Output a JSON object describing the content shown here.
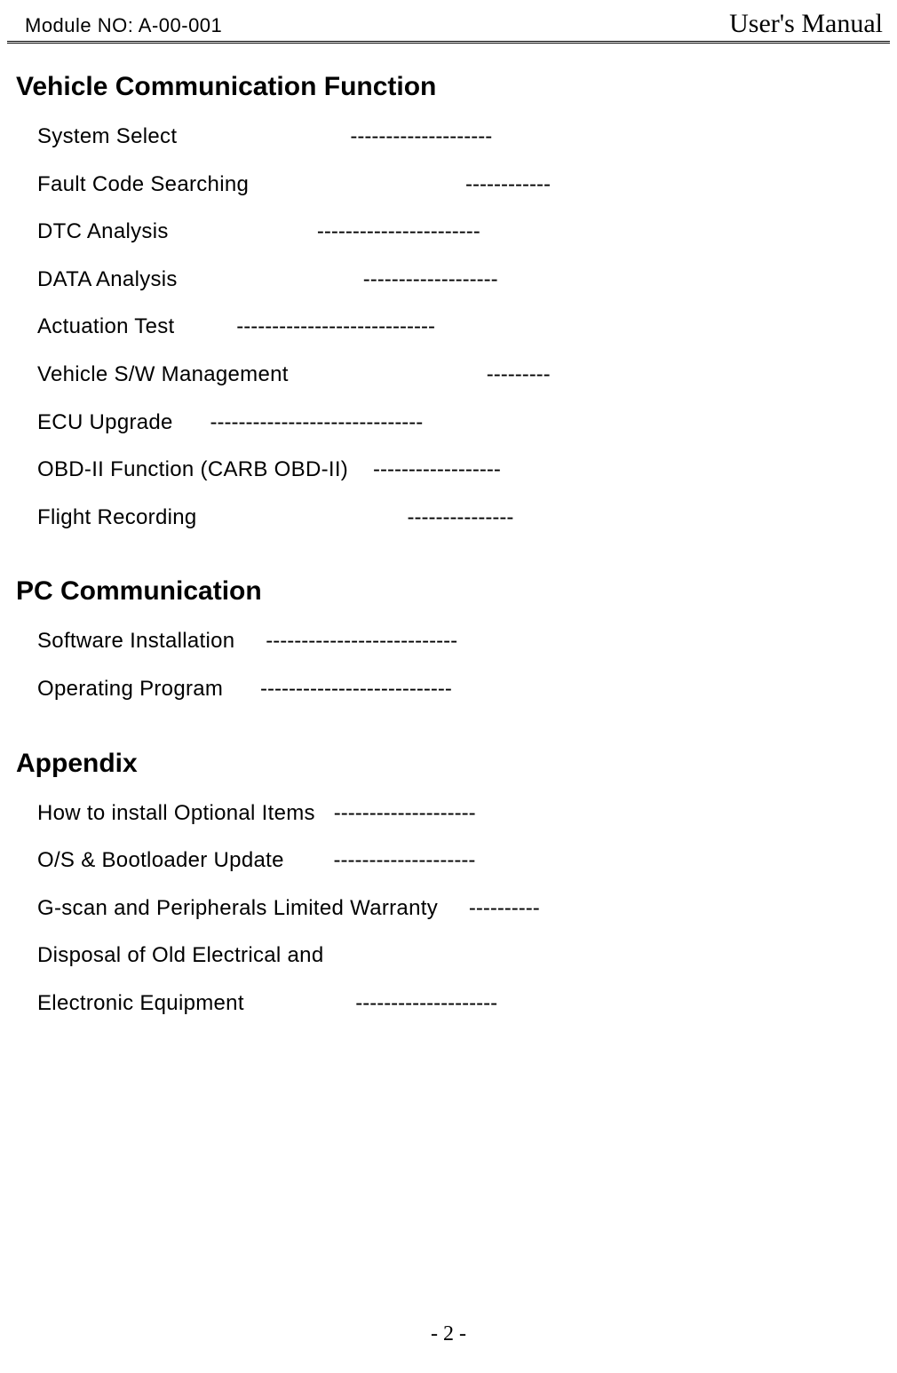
{
  "header": {
    "module_no": "Module NO: A-00-001",
    "manual_title": "User's Manual"
  },
  "sections": [
    {
      "heading": "Vehicle Communication Function",
      "items": [
        {
          "label": "System Select",
          "dashes": "--------------------"
        },
        {
          "label": "Fault Code Searching",
          "dashes": "------------"
        },
        {
          "label": "DTC Analysis",
          "dashes": "-----------------------"
        },
        {
          "label": "DATA Analysis",
          "dashes": "-------------------"
        },
        {
          "label": "Actuation Test",
          "dashes": "----------------------------"
        },
        {
          "label": "Vehicle S/W Management",
          "dashes": "---------"
        },
        {
          "label": "ECU Upgrade",
          "dashes": "------------------------------"
        },
        {
          "label": "OBD-II Function (CARB OBD-II)",
          "dashes": "------------------"
        },
        {
          "label": "Flight Recording",
          "dashes": "---------------"
        }
      ]
    },
    {
      "heading": "PC Communication",
      "items": [
        {
          "label": "Software Installation",
          "dashes": "---------------------------"
        },
        {
          "label": "Operating Program",
          "dashes": "---------------------------"
        }
      ]
    },
    {
      "heading": "Appendix",
      "items": [
        {
          "label": "How to install Optional Items",
          "dashes": "--------------------"
        },
        {
          "label": "O/S & Bootloader Update",
          "dashes": "--------------------"
        },
        {
          "label": "G-scan and Peripherals Limited Warranty",
          "dashes": "----------"
        },
        {
          "label": "Disposal of Old Electrical and",
          "dashes": ""
        },
        {
          "label": "Electronic Equipment",
          "dashes": "--------------------"
        }
      ]
    }
  ],
  "page_number": "- 2 -",
  "layout": {
    "spacers": {
      "0": {
        "0": "                            ",
        "1": "                                   ",
        "2": "                        ",
        "3": "                              ",
        "4": "          ",
        "5": "                                ",
        "6": "      ",
        "7": "    ",
        "8": "                                  "
      },
      "1": {
        "0": "     ",
        "1": "      "
      },
      "2": {
        "0": "   ",
        "1": "        ",
        "2": "     ",
        "3": "",
        "4": "                  "
      }
    }
  }
}
